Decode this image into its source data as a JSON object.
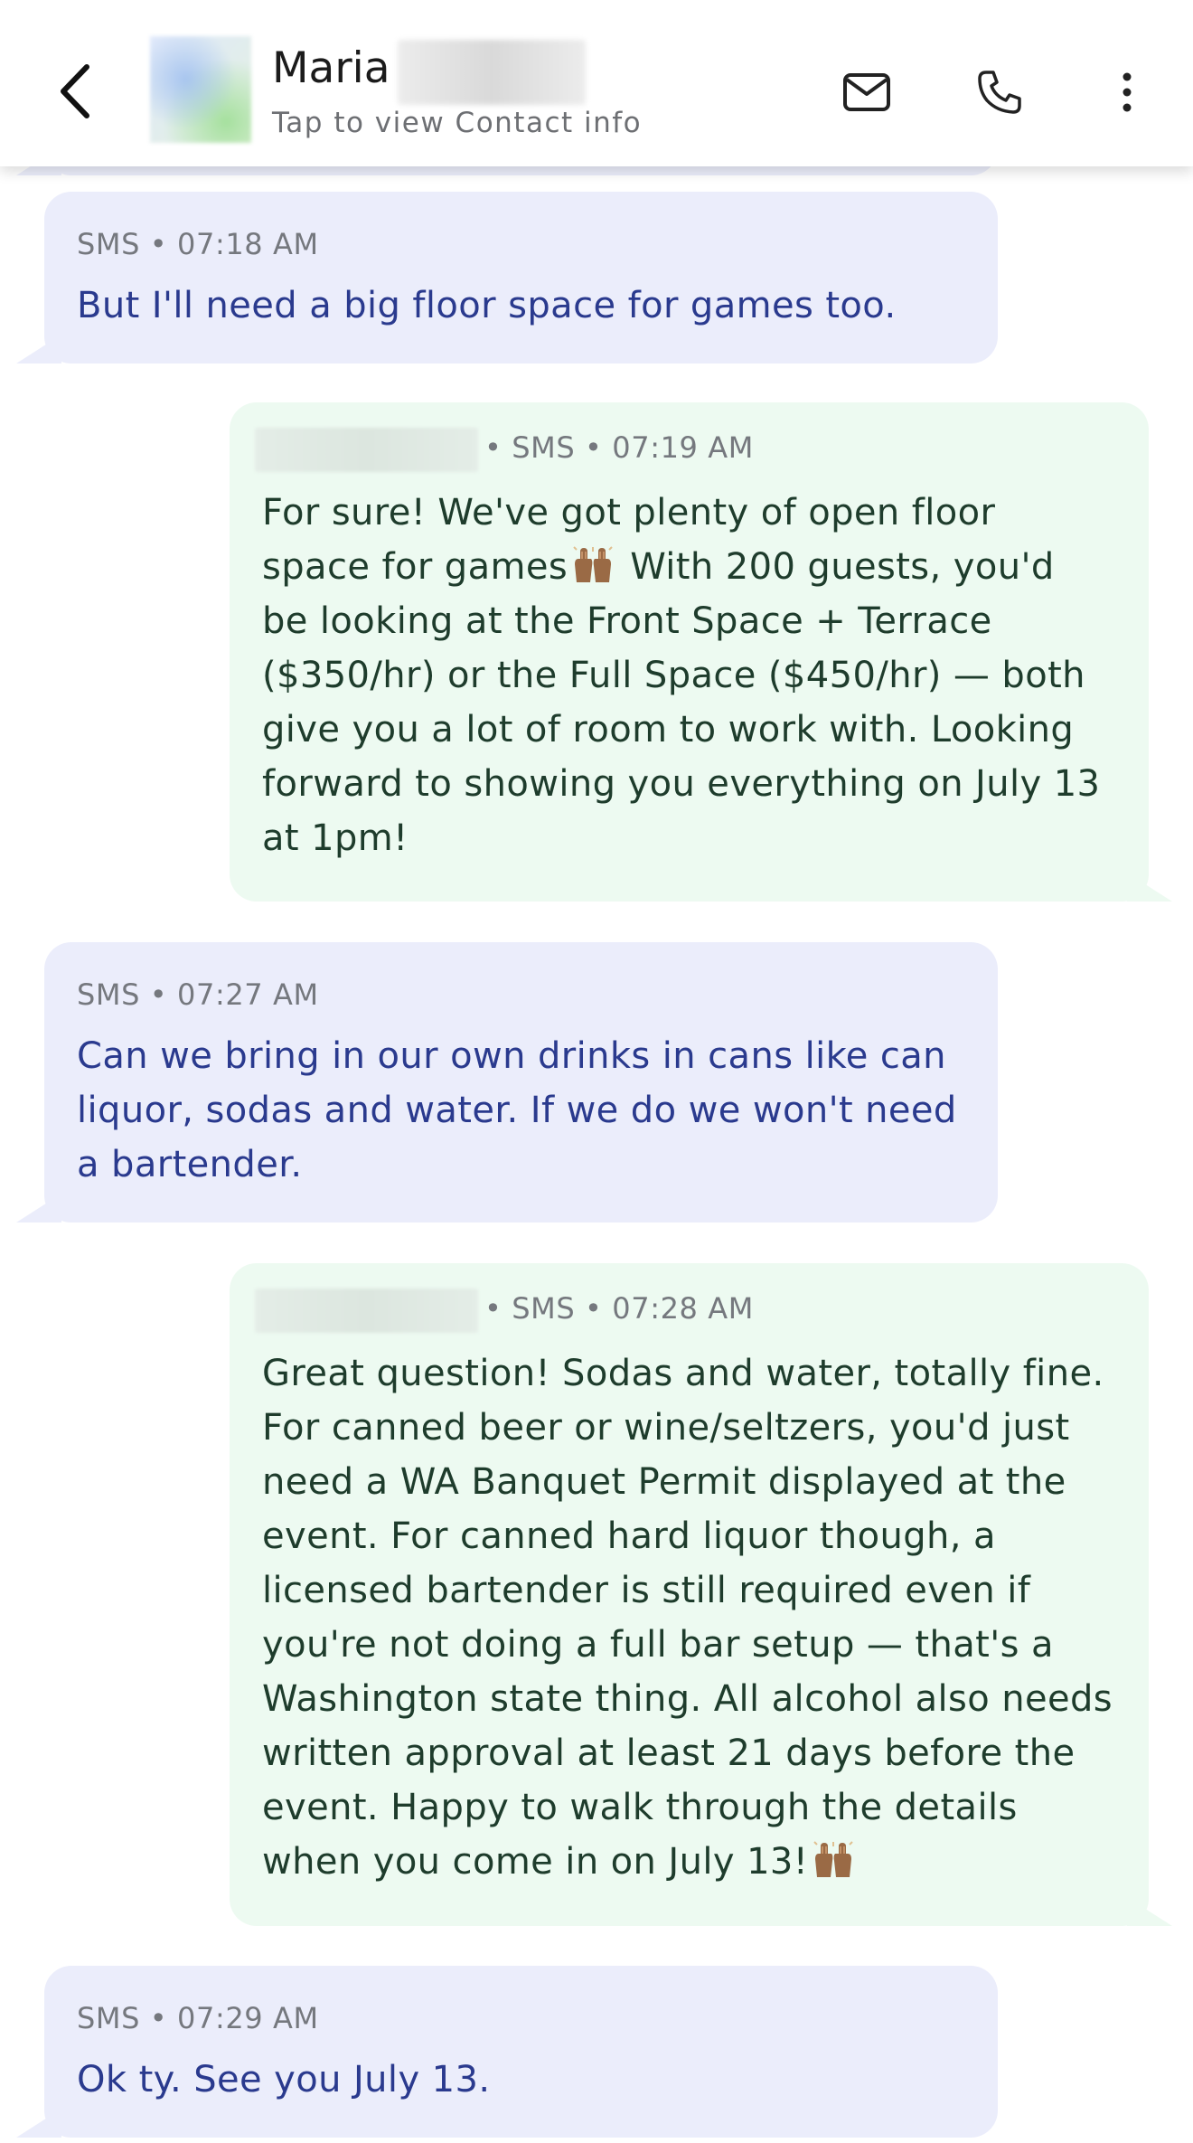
{
  "header": {
    "contact_first_name": "Maria",
    "subtitle": "Tap to view Contact info",
    "icons": {
      "back": "back-arrow-icon",
      "mail": "mail-icon",
      "phone": "phone-icon",
      "more": "more-vertical-icon"
    }
  },
  "colors": {
    "incoming_bubble": "#ebedfb",
    "incoming_text": "#2a3a8e",
    "outgoing_bubble": "#edfaf1",
    "outgoing_text": "#1e3c2c",
    "meta_text": "#75787e"
  },
  "messages": [
    {
      "direction": "incoming",
      "meta": "SMS • 07:18 AM",
      "text": "But I'll need a big floor space for games too."
    },
    {
      "direction": "outgoing",
      "meta": "• SMS • 07:19 AM",
      "text_1": "For sure! We've got plenty of open floor\nspace for games",
      "emoji": "raising-hands-emoji",
      "text_2": " With 200 guests, you'd\nbe looking at the Front Space + Terrace\n($350/hr) or the Full Space ($450/hr) — both\ngive you a lot of room to work with. Looking\nforward to showing you everything on July 13\nat 1pm!"
    },
    {
      "direction": "incoming",
      "meta": "SMS • 07:27 AM",
      "text": "Can we bring in our own drinks in cans like can\nliquor, sodas and water. If we do we won't need\na bartender."
    },
    {
      "direction": "outgoing",
      "meta": "• SMS • 07:28 AM",
      "text_1": "Great question! Sodas and water, totally fine.\nFor canned beer or wine/seltzers, you'd just\nneed a WA Banquet Permit displayed at the\nevent. For canned hard liquor though, a\nlicensed bartender is still required even if\nyou're not doing a full bar setup — that's a\nWashington state thing. All alcohol also needs\nwritten approval at least 21 days before the\nevent. Happy to walk through the details\nwhen you come in on July 13!",
      "emoji": "raising-hands-emoji"
    },
    {
      "direction": "incoming",
      "meta": "SMS • 07:29 AM",
      "text": "Ok ty. See you July 13."
    }
  ]
}
